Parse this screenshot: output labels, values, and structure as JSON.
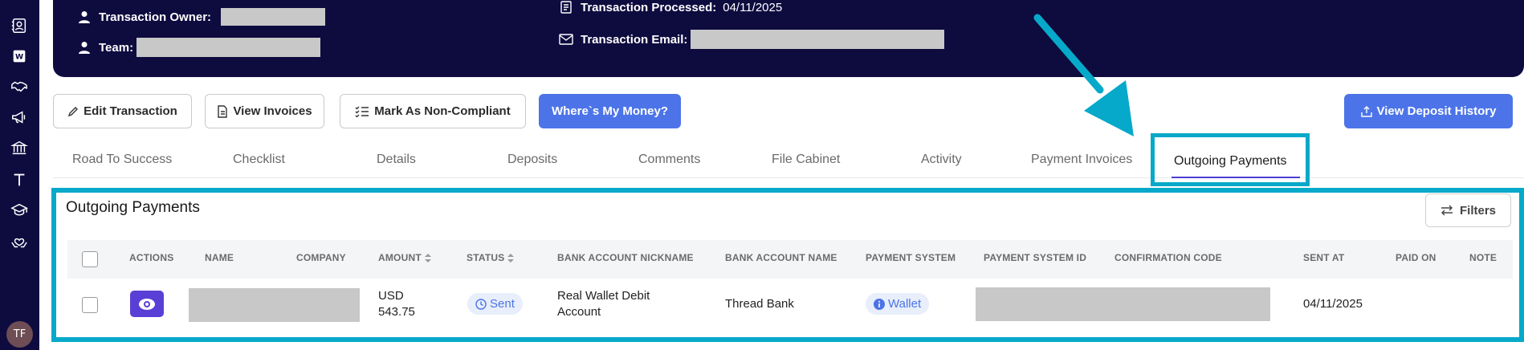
{
  "sidebar": {
    "icons": [
      "contacts-icon",
      "wallet-icon",
      "handshake-icon",
      "megaphone-icon",
      "bank-icon",
      "text-icon",
      "graduation-cap-icon",
      "helping-hands-icon"
    ],
    "avatar_initials": "TF"
  },
  "header": {
    "owner_label": "Transaction Owner:",
    "team_label": "Team:",
    "processed_label": "Transaction Processed:",
    "processed_value": "04/11/2025",
    "email_label": "Transaction Email:"
  },
  "actions": {
    "edit": "Edit Transaction",
    "view_invoices": "View Invoices",
    "non_compliant": "Mark As Non-Compliant",
    "wheres_money": "Where`s My Money?",
    "deposit_history": "View Deposit History"
  },
  "tabs": [
    "Road To Success",
    "Checklist",
    "Details",
    "Deposits",
    "Comments",
    "File Cabinet",
    "Activity",
    "Payment Invoices",
    "Outgoing Payments"
  ],
  "active_tab": "Outgoing Payments",
  "panel": {
    "title": "Outgoing Payments",
    "filters_label": "Filters"
  },
  "table": {
    "columns": [
      "ACTIONS",
      "NAME",
      "COMPANY",
      "AMOUNT",
      "STATUS",
      "BANK ACCOUNT NICKNAME",
      "BANK ACCOUNT NAME",
      "PAYMENT SYSTEM",
      "PAYMENT SYSTEM ID",
      "CONFIRMATION CODE",
      "SENT AT",
      "PAID ON",
      "NOTE"
    ],
    "rows": [
      {
        "amount_currency": "USD",
        "amount_value": "543.75",
        "status": "Sent",
        "bank_nickname_line1": "Real Wallet Debit",
        "bank_nickname_line2": "Account",
        "bank_name": "Thread Bank",
        "payment_system": "Wallet",
        "sent_at": "04/11/2025"
      }
    ]
  },
  "colors": {
    "navy": "#0e0b3f",
    "primary": "#4c74e8",
    "highlight": "#06a9c9",
    "action_purple": "#5a3fd6"
  }
}
